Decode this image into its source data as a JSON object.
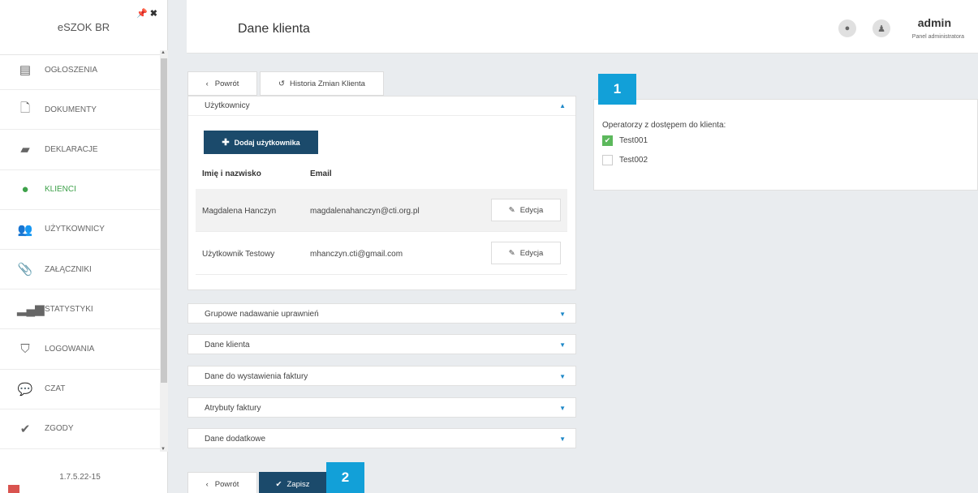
{
  "sidebar": {
    "brand": "eSZOK BR",
    "pin_icon": "pin-icon",
    "close_icon": "close-icon",
    "items": [
      {
        "label": "OGŁOSZENIA",
        "icon": "newspaper-icon",
        "glyph": "▤"
      },
      {
        "label": "DOKUMENTY",
        "icon": "document-icon",
        "glyph": "🗋"
      },
      {
        "label": "DEKLARACJE",
        "icon": "book-icon",
        "glyph": "▰"
      },
      {
        "label": "KLIENCI",
        "icon": "globe-icon",
        "glyph": "●",
        "active": true
      },
      {
        "label": "UŻYTKOWNICY",
        "icon": "users-icon",
        "glyph": "👥"
      },
      {
        "label": "ZAŁĄCZNIKI",
        "icon": "paperclip-icon",
        "glyph": "📎"
      },
      {
        "label": "STATYSTYKI",
        "icon": "signal-icon",
        "glyph": "▂▄▆"
      },
      {
        "label": "LOGOWANIA",
        "icon": "shield-icon",
        "glyph": "⛉"
      },
      {
        "label": "CZAT",
        "icon": "chat-icon",
        "glyph": "💬"
      },
      {
        "label": "ZGODY",
        "icon": "check-icon",
        "glyph": "✔"
      }
    ],
    "version": "1.7.5.22-15"
  },
  "header": {
    "title": "Dane klienta",
    "user_name": "admin",
    "user_role": "Panel administratora"
  },
  "toolbar": {
    "back_label": "Powrót",
    "history_label": "Historia Zmian Klienta"
  },
  "users_panel": {
    "title": "Użytkownicy",
    "add_label": "Dodaj użytkownika",
    "columns": [
      "Imię i nazwisko",
      "Email"
    ],
    "rows": [
      {
        "name": "Magdalena Hanczyn",
        "email": "magdalenahanczyn@cti.org.pl",
        "edit": "Edycja"
      },
      {
        "name": "Użytkownik Testowy",
        "email": "mhanczyn.cti@gmail.com",
        "edit": "Edycja"
      }
    ]
  },
  "sections": [
    "Grupowe nadawanie uprawnień",
    "Dane klienta",
    "Dane do wystawienia faktury",
    "Atrybuty faktury",
    "Dane dodatkowe"
  ],
  "operators": {
    "label": "Operatorzy z dostępem do klienta:",
    "items": [
      {
        "name": "Test001",
        "checked": true
      },
      {
        "name": "Test002",
        "checked": false
      }
    ]
  },
  "footer": {
    "back_label": "Powrót",
    "save_label": "Zapisz"
  },
  "badges": [
    "1",
    "2"
  ],
  "colors": {
    "primary": "#1b4a6b",
    "accent": "#12a0d8",
    "active": "#3ea14a",
    "checkbox": "#5cb85c"
  }
}
